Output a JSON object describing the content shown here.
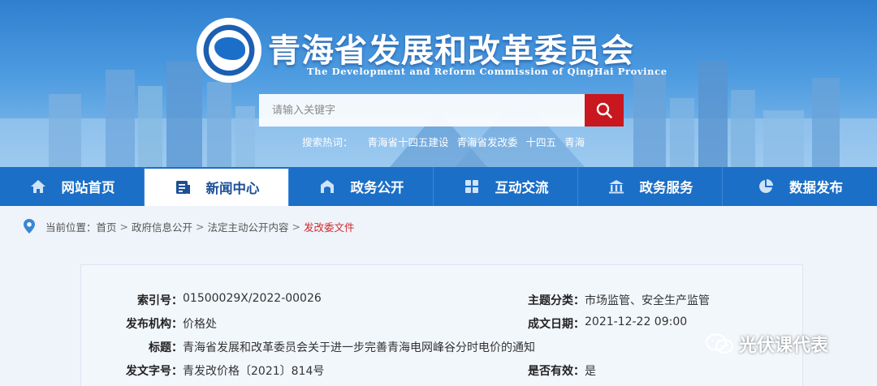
{
  "header": {
    "title": "青海省发展和改革委员会",
    "subtitle": "The Development and Reform Commission of QingHai Province",
    "search": {
      "placeholder": "请输入关键字"
    },
    "hot": {
      "label": "搜索热词：",
      "keywords": [
        "青海省十四五建设",
        "青海省发改委",
        "十四五",
        "青海"
      ]
    }
  },
  "nav": {
    "items": [
      {
        "label": "网站首页",
        "icon": "home-icon"
      },
      {
        "label": "新闻中心",
        "icon": "news-icon"
      },
      {
        "label": "政务公开",
        "icon": "government-building-icon"
      },
      {
        "label": "互动交流",
        "icon": "grid-icon"
      },
      {
        "label": "政务服务",
        "icon": "bank-icon"
      },
      {
        "label": "数据发布",
        "icon": "pie-chart-icon"
      }
    ],
    "active_index": 1
  },
  "breadcrumb": {
    "prefix": "当前位置：",
    "items": [
      "首页",
      "政府信息公开",
      "法定主动公开内容",
      "发改委文件"
    ],
    "separator": ">"
  },
  "doc_info": {
    "index_no": {
      "label": "索引号：",
      "value": "01500029X/2022-00026"
    },
    "category": {
      "label": "主题分类：",
      "value": "市场监管、安全生产监管"
    },
    "publisher": {
      "label": "发布机构：",
      "value": "价格处"
    },
    "created_date": {
      "label": "成文日期：",
      "value": "2021-12-22 09:00"
    },
    "title": {
      "label": "标题：",
      "value": "青海省发展和改革委员会关于进一步完善青海电网峰谷分时电价的通知"
    },
    "doc_no": {
      "label": "发文字号：",
      "value": "青发改价格〔2021〕814号"
    },
    "valid": {
      "label": "是否有效：",
      "value": "是"
    }
  },
  "watermark": {
    "text": "光伏课代表"
  },
  "colors": {
    "nav_bg": "#1b6fc7",
    "search_btn": "#c8171e",
    "crumb_current": "#d2262b"
  }
}
